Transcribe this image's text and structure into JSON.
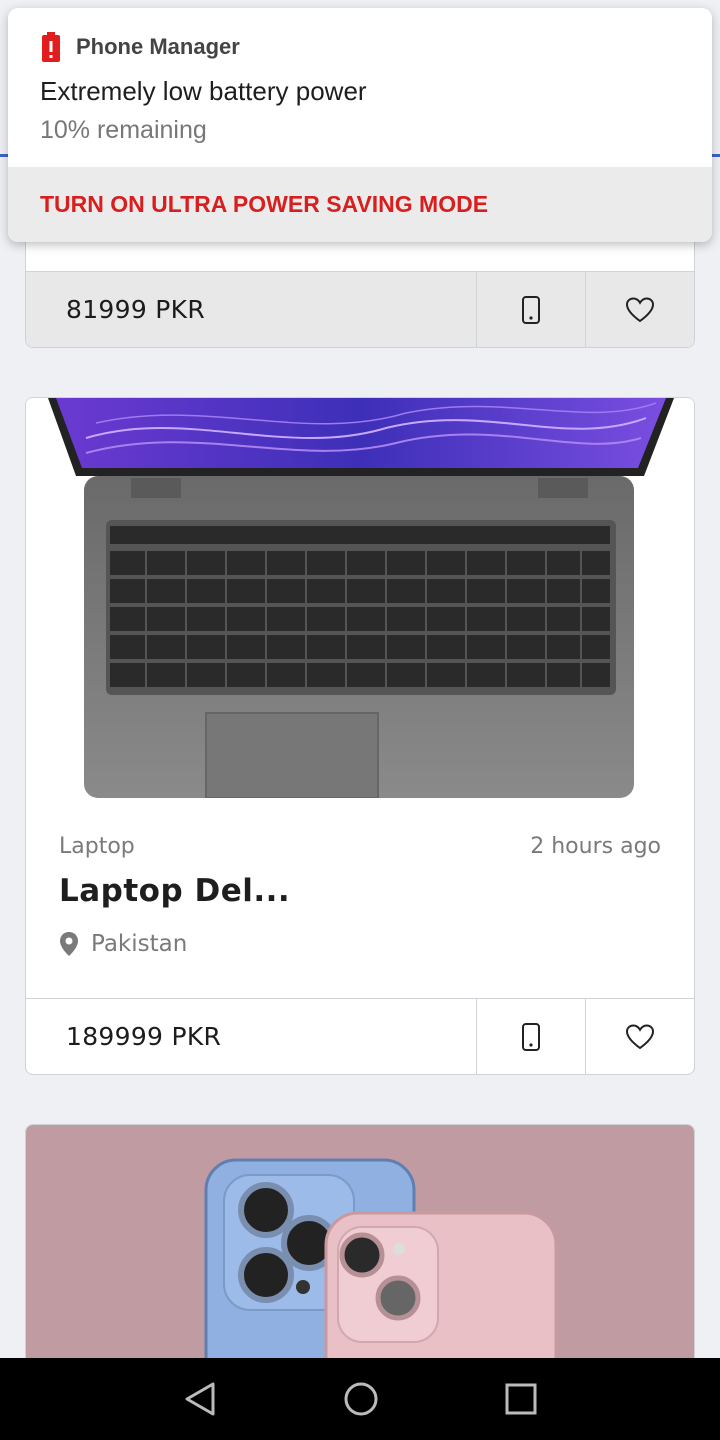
{
  "notification": {
    "app_name": "Phone Manager",
    "title": "Extremely low battery power",
    "subtitle": "10% remaining",
    "action_label": "TURN ON ULTRA POWER SAVING MODE",
    "accent_color": "#d81e1e"
  },
  "listings": [
    {
      "price": "81999 PKR"
    },
    {
      "category": "Laptop",
      "time": "2 hours ago",
      "title": "Laptop Del...",
      "location": "Pakistan",
      "price": "189999 PKR"
    },
    {
      "image": "phones-photo"
    }
  ],
  "icons": {
    "call": "phone-icon",
    "favorite": "heart-icon",
    "location": "location-pin-icon"
  },
  "nav": [
    "back-icon",
    "home-icon",
    "recents-icon"
  ]
}
